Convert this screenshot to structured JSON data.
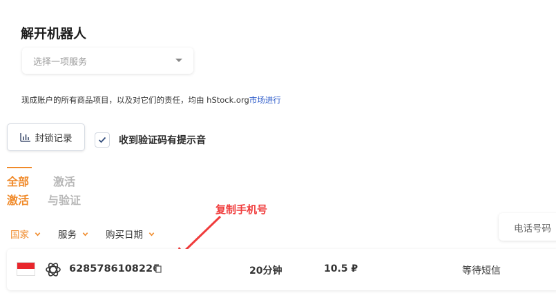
{
  "header": {
    "title": "解开机器人"
  },
  "service_select": {
    "placeholder": "选择一项服务"
  },
  "notice": {
    "text": "现成账户的所有商品项目，以及对它们的责任，均由 hStock.org",
    "link": "市场进行"
  },
  "block_history_button": {
    "label": "封锁记录"
  },
  "sound_checkbox": {
    "label": "收到验证码有提示音",
    "checked": true
  },
  "tabs": [
    {
      "label_line1": "全部",
      "label_line2": "激活",
      "active": true
    },
    {
      "label_line1": "激活",
      "label_line2": "与验证",
      "active": false
    }
  ],
  "annotation": {
    "text": "复制手机号",
    "color": "#f03c3c"
  },
  "filters": {
    "country": "国家",
    "service": "服务",
    "purchase_date": "购买日期"
  },
  "phone_search": {
    "text": "电话号码"
  },
  "order_row": {
    "country_flag": "indonesia-flag",
    "service_icon": "openai-icon",
    "phone_number": "6285786108226",
    "duration": "20分钟",
    "price": "10.5 ₽",
    "status": "等待短信"
  },
  "colors": {
    "accent": "#f08a2a",
    "link": "#2a59c9",
    "annotation": "#f03c3c"
  }
}
